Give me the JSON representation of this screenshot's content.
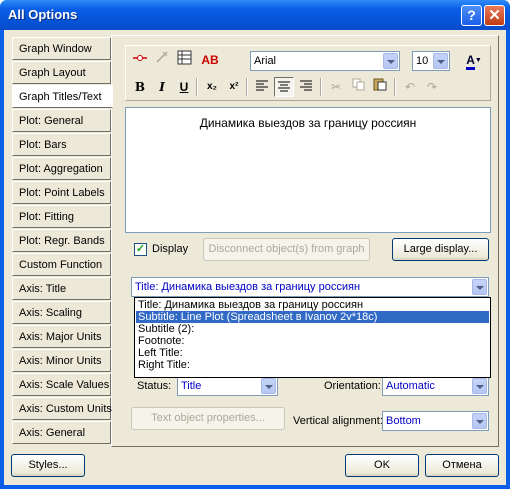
{
  "window": {
    "title": "All Options"
  },
  "titlebar_buttons": {
    "help": "?",
    "close": "✕"
  },
  "tabs": [
    "Graph Window",
    "Graph Layout",
    "Graph Titles/Text",
    "Plot: General",
    "Plot: Bars",
    "Plot: Aggregation",
    "Plot: Point Labels",
    "Plot: Fitting",
    "Plot: Regr. Bands",
    "Custom Function",
    "Axis: Title",
    "Axis: Scaling",
    "Axis: Major Units",
    "Axis: Minor Units",
    "Axis: Scale Values",
    "Axis: Custom Units",
    "Axis: General"
  ],
  "active_tab": "Graph Titles/Text",
  "toolbar": {
    "font_name": "Arial",
    "font_size": "10",
    "icons": [
      "link-icon",
      "unlink-icon",
      "table-icon",
      "spell-ab-icon",
      "font-color-icon",
      "bold-icon",
      "italic-icon",
      "underline-icon",
      "subscript-icon",
      "superscript-icon",
      "align-left-icon",
      "align-center-icon",
      "align-right-icon",
      "cut-icon",
      "copy-icon",
      "paste-icon",
      "undo-icon",
      "redo-icon"
    ],
    "glyphs": {
      "bold": "B",
      "italic": "I",
      "underline": "U",
      "subscript": "x₂",
      "superscript": "x²",
      "spell": "AB",
      "font_color": "A"
    }
  },
  "editor": {
    "text": "Динамика выездов за границу россиян"
  },
  "display_checkbox": {
    "label": "Display",
    "checked": true
  },
  "buttons": {
    "disconnect": "Disconnect object(s) from graph",
    "large_display": "Large display...",
    "text_object_properties": "Text object properties...",
    "styles": "Styles...",
    "ok": "OK",
    "cancel": "Отмена"
  },
  "title_select": {
    "value": "Title: Динамика выездов за границу россиян",
    "options": [
      "Title: Динамика выездов за границу россиян",
      "Subtitle: Line Plot (Spreadsheet в Ivanov 2v*18c)",
      "Subtitle (2):",
      "Footnote:",
      "Left Title:",
      "Right Title:"
    ],
    "highlighted_index": 1
  },
  "status": {
    "label": "Status:",
    "value": "Title"
  },
  "orientation": {
    "label": "Orientation:",
    "value": "Automatic"
  },
  "vertical_alignment": {
    "label": "Vertical alignment:",
    "value": "Bottom"
  },
  "colors": {
    "accent_blue": "#0000c8",
    "selection": "#316ac5",
    "titlebar": "#0a5ee8"
  }
}
